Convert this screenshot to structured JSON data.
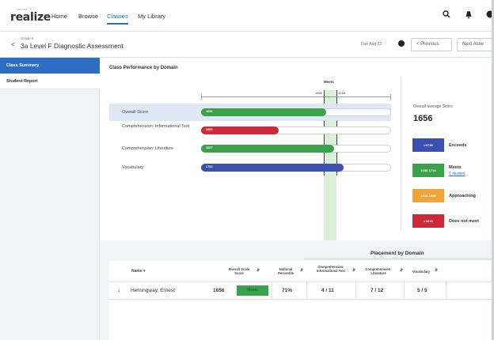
{
  "brand": {
    "superscript": "savvas ™",
    "word": "realize"
  },
  "nav": {
    "items": [
      {
        "label": "Home",
        "active": false
      },
      {
        "label": "Browse",
        "active": false
      },
      {
        "label": "Classes",
        "active": true
      },
      {
        "label": "My Library",
        "active": false
      }
    ]
  },
  "top_icons": [
    "search-icon",
    "bell-icon",
    "help-icon"
  ],
  "subheader": {
    "back_icon": "<",
    "breadcrumb": "Grade 6",
    "title": "3a Level F Diagnostic Assessment",
    "due": "Due Aug 22",
    "prev_label": "< Previous",
    "next_label": "Next Asse"
  },
  "sidebar": {
    "items": [
      {
        "label": "Class Summary",
        "active": true
      },
      {
        "label": "Student Report",
        "active": false
      }
    ]
  },
  "domain_card": {
    "title": "Class Performance by Domain",
    "meets_label": "Meets",
    "meets_range": [
      "1656",
      "1718"
    ],
    "rows": [
      {
        "label": "Overall Score",
        "value": "1656",
        "fraction": 0.66,
        "color": "#3aa24a",
        "highlight": true
      },
      {
        "label": "Comprehension: Informational Text",
        "value": "1589",
        "fraction": 0.41,
        "color": "#cc2a3a",
        "highlight": false
      },
      {
        "label": "Comprehension: Literature",
        "value": "1687",
        "fraction": 0.7,
        "color": "#3aa24a",
        "highlight": false
      },
      {
        "label": "Vocabulary",
        "value": "1744",
        "fraction": 0.75,
        "color": "#3b4fb0",
        "highlight": false
      }
    ],
    "average_label": "Overall average Score",
    "average_value": "1656",
    "legend": [
      {
        "range": ">1718",
        "label": "Exceeds",
        "color": "#3b4fb0",
        "link": ""
      },
      {
        "range": "1656-1718",
        "label": "Meets",
        "color": "#3aa24a",
        "link": "1 student"
      },
      {
        "range": "1614-1655",
        "label": "Approaching",
        "color": "#f2a33a",
        "link": ""
      },
      {
        "range": "<1614",
        "label": "Does not meet",
        "color": "#cc2a3a",
        "link": ""
      }
    ]
  },
  "table": {
    "placement_title": "Placement by Domain",
    "headers": {
      "name": "Name",
      "overall": "Overall Scale Score",
      "national": "National Percentile",
      "info": "Comprehension: Informational Text",
      "lit": "Comprehension: Literature",
      "vocab": "Vocabulary"
    },
    "rows": [
      {
        "name": "Hemingway, Ernest",
        "score": "1656",
        "badge": "Meets",
        "percentile": "71%",
        "info": "4 / 11",
        "lit": "7 / 12",
        "vocab": "5 / 5"
      }
    ]
  }
}
